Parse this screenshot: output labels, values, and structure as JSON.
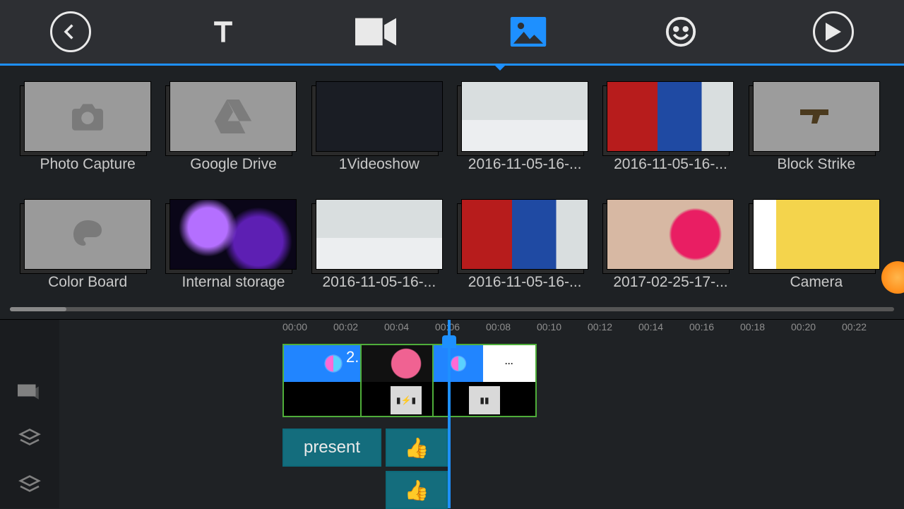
{
  "accent": "#1e90ff",
  "toolbar": {
    "active_index": 3,
    "items": [
      {
        "name": "back",
        "icon": "arrow-left"
      },
      {
        "name": "text",
        "icon": "text"
      },
      {
        "name": "video",
        "icon": "camcorder"
      },
      {
        "name": "photo",
        "icon": "photo"
      },
      {
        "name": "emoji",
        "icon": "smile"
      },
      {
        "name": "play",
        "icon": "play"
      }
    ]
  },
  "media_grid": {
    "row1": [
      {
        "label": "Photo Capture",
        "kind": "photo-capture",
        "thumb": "light"
      },
      {
        "label": "Google Drive",
        "kind": "google-drive",
        "thumb": "light"
      },
      {
        "label": "1Videoshow",
        "kind": "editor",
        "thumb": "editor"
      },
      {
        "label": "2016-11-05-16-...",
        "kind": "photo",
        "thumb": "snow"
      },
      {
        "label": "2016-11-05-16-...",
        "kind": "photo",
        "thumb": "bear"
      },
      {
        "label": "Block Strike",
        "kind": "game",
        "thumb": "gunbg"
      }
    ],
    "row2": [
      {
        "label": "Color Board",
        "kind": "color-board",
        "thumb": "light"
      },
      {
        "label": "Internal storage",
        "kind": "storage",
        "thumb": "nebula"
      },
      {
        "label": "2016-11-05-16-...",
        "kind": "photo",
        "thumb": "snow"
      },
      {
        "label": "2016-11-05-16-...",
        "kind": "photo",
        "thumb": "bear"
      },
      {
        "label": "2017-02-25-17-...",
        "kind": "photo",
        "thumb": "flower"
      },
      {
        "label": "Camera",
        "kind": "camera",
        "thumb": "fifa"
      }
    ]
  },
  "timeline": {
    "ticks": [
      "00:00",
      "00:02",
      "00:04",
      "00:06",
      "00:08",
      "00:10",
      "00:12",
      "00:14",
      "00:16",
      "00:18",
      "00:20",
      "00:22"
    ],
    "playhead": "00:06",
    "clips": [
      {
        "start": "00:00",
        "len": 2,
        "label": "2...",
        "type": "photo"
      },
      {
        "start": "00:02",
        "len": 2,
        "type": "flower"
      },
      {
        "start": "00:04",
        "len": 3,
        "type": "photo-text"
      }
    ],
    "tags": [
      {
        "track": 1,
        "label": "present",
        "kind": "text"
      },
      {
        "track": 1,
        "label": "👍",
        "kind": "sticker"
      },
      {
        "track": 2,
        "label": "👍",
        "kind": "sticker"
      }
    ]
  }
}
